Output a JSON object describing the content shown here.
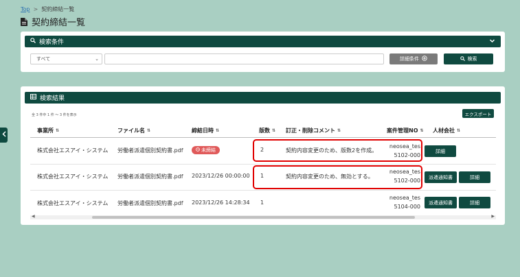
{
  "breadcrumb": {
    "top": "Top",
    "separator": ">",
    "current": "契約締結一覧"
  },
  "page": {
    "title": "契約締結一覧"
  },
  "search": {
    "header": "検索条件",
    "scope_value": "すべて",
    "keyword_value": "",
    "advanced_label": "詳細条件",
    "search_label": "検索"
  },
  "results": {
    "header": "検索結果",
    "count_text": "全 3 件中 1 件 ～ 3 件を表示",
    "export_label": "エクスポート",
    "columns": {
      "office": "事業所",
      "file_name": "ファイル名",
      "signed_at": "締結日時",
      "version": "版数",
      "comment": "訂正・削除コメント",
      "case_no": "案件管理NO",
      "agency": "人材会社"
    },
    "rows": [
      {
        "office": "株式会社エスアイ・システム",
        "file_name": "労働者派遣個別契約書.pdf",
        "status_badge": "未締結",
        "signed_at": "",
        "version": "2",
        "comment": "契約内容変更のため、版数2を作成。",
        "case_no_line1": "neosea_tes",
        "case_no_line2": "5102-000",
        "buttons": [
          "詳細"
        ]
      },
      {
        "office": "株式会社エスアイ・システム",
        "file_name": "労働者派遣個別契約書.pdf",
        "status_badge": "",
        "signed_at": "2023/12/26 00:00:00",
        "version": "1",
        "comment": "契約内容変更のため、無効とする。",
        "case_no_line1": "neosea_tes",
        "case_no_line2": "5102-000",
        "buttons": [
          "派遣通知書",
          "詳細"
        ]
      },
      {
        "office": "株式会社エスアイ・システム",
        "file_name": "労働者派遣個別契約書.pdf",
        "status_badge": "",
        "signed_at": "2023/12/26 14:28:34",
        "version": "1",
        "comment": "",
        "case_no_line1": "neosea_tes",
        "case_no_line2": "5104-000",
        "buttons": [
          "派遣通知書",
          "詳細"
        ]
      }
    ]
  },
  "colors": {
    "primary": "#0f4a40",
    "background": "#a9cfc2",
    "badge": "#e05a5a",
    "highlight": "#e00000"
  }
}
